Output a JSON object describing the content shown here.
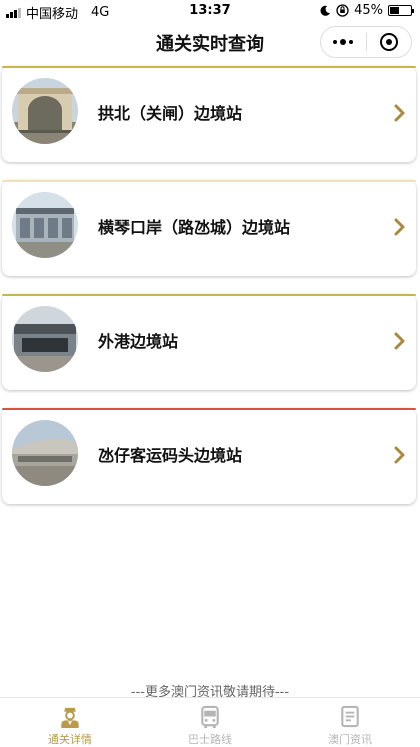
{
  "status_bar": {
    "carrier": "中国移动",
    "network": "4G",
    "time": "13:37",
    "battery": "45%"
  },
  "header": {
    "title": "通关实时查询"
  },
  "ports": [
    {
      "label": "拱北（关闸）边境站",
      "accent": "#c9b64a",
      "icon": "arch-gate-photo"
    },
    {
      "label": "横琴口岸（路氹城）边境站",
      "accent": "#f0e3b0",
      "icon": "building-photo"
    },
    {
      "label": "外港边境站",
      "accent": "#c9b64a",
      "icon": "terminal-photo"
    },
    {
      "label": "氹仔客运码头边境站",
      "accent": "#d9523a",
      "icon": "ferry-terminal-photo"
    }
  ],
  "footer_note": "---更多澳门资讯敬请期待---",
  "tabs": [
    {
      "label": "通关详情",
      "icon": "officer-icon",
      "active": true,
      "color": "#b89a4a"
    },
    {
      "label": "巴士路线",
      "icon": "bus-icon",
      "active": false,
      "color": "#b5b5b5"
    },
    {
      "label": "澳门资讯",
      "icon": "document-icon",
      "active": false,
      "color": "#b5b5b5"
    }
  ],
  "colors": {
    "chevron": "#a8893e",
    "active_tab": "#b89a4a",
    "inactive_tab": "#b5b5b5"
  }
}
